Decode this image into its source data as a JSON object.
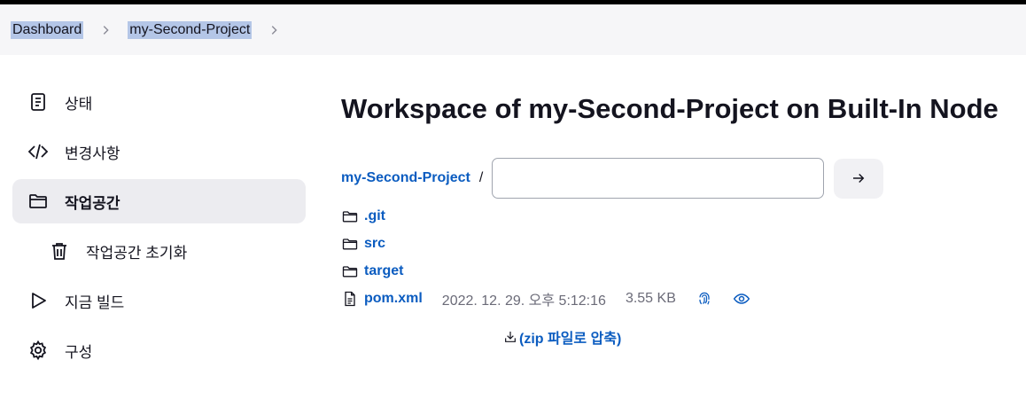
{
  "breadcrumbs": [
    "Dashboard",
    "my-Second-Project"
  ],
  "sidebar": {
    "items": [
      {
        "label": "상태",
        "icon": "document-icon"
      },
      {
        "label": "변경사항",
        "icon": "code-icon"
      },
      {
        "label": "작업공간",
        "icon": "folder-icon"
      },
      {
        "label": "작업공간 초기화",
        "icon": "trash-icon"
      },
      {
        "label": "지금 빌드",
        "icon": "play-icon"
      },
      {
        "label": "구성",
        "icon": "gear-icon"
      }
    ],
    "active_item": "작업공간"
  },
  "main": {
    "title": "Workspace of my-Second-Project on Built-In Node",
    "path_root": "my-Second-Project",
    "path_separator": "/",
    "path_input_value": "",
    "files": [
      {
        "name": ".git",
        "type": "folder"
      },
      {
        "name": "src",
        "type": "folder"
      },
      {
        "name": "target",
        "type": "folder"
      },
      {
        "name": "pom.xml",
        "type": "file",
        "date": "2022. 12. 29. 오후 5:12:16",
        "size": "3.55 KB"
      }
    ],
    "zip_label": "(zip 파일로 압축)"
  },
  "colors": {
    "link": "#0b5cc0",
    "breadcrumb_highlight": "#b4c6e7",
    "active_bg": "#ececf0",
    "breadcrumb_bg": "#f6f6f8"
  }
}
